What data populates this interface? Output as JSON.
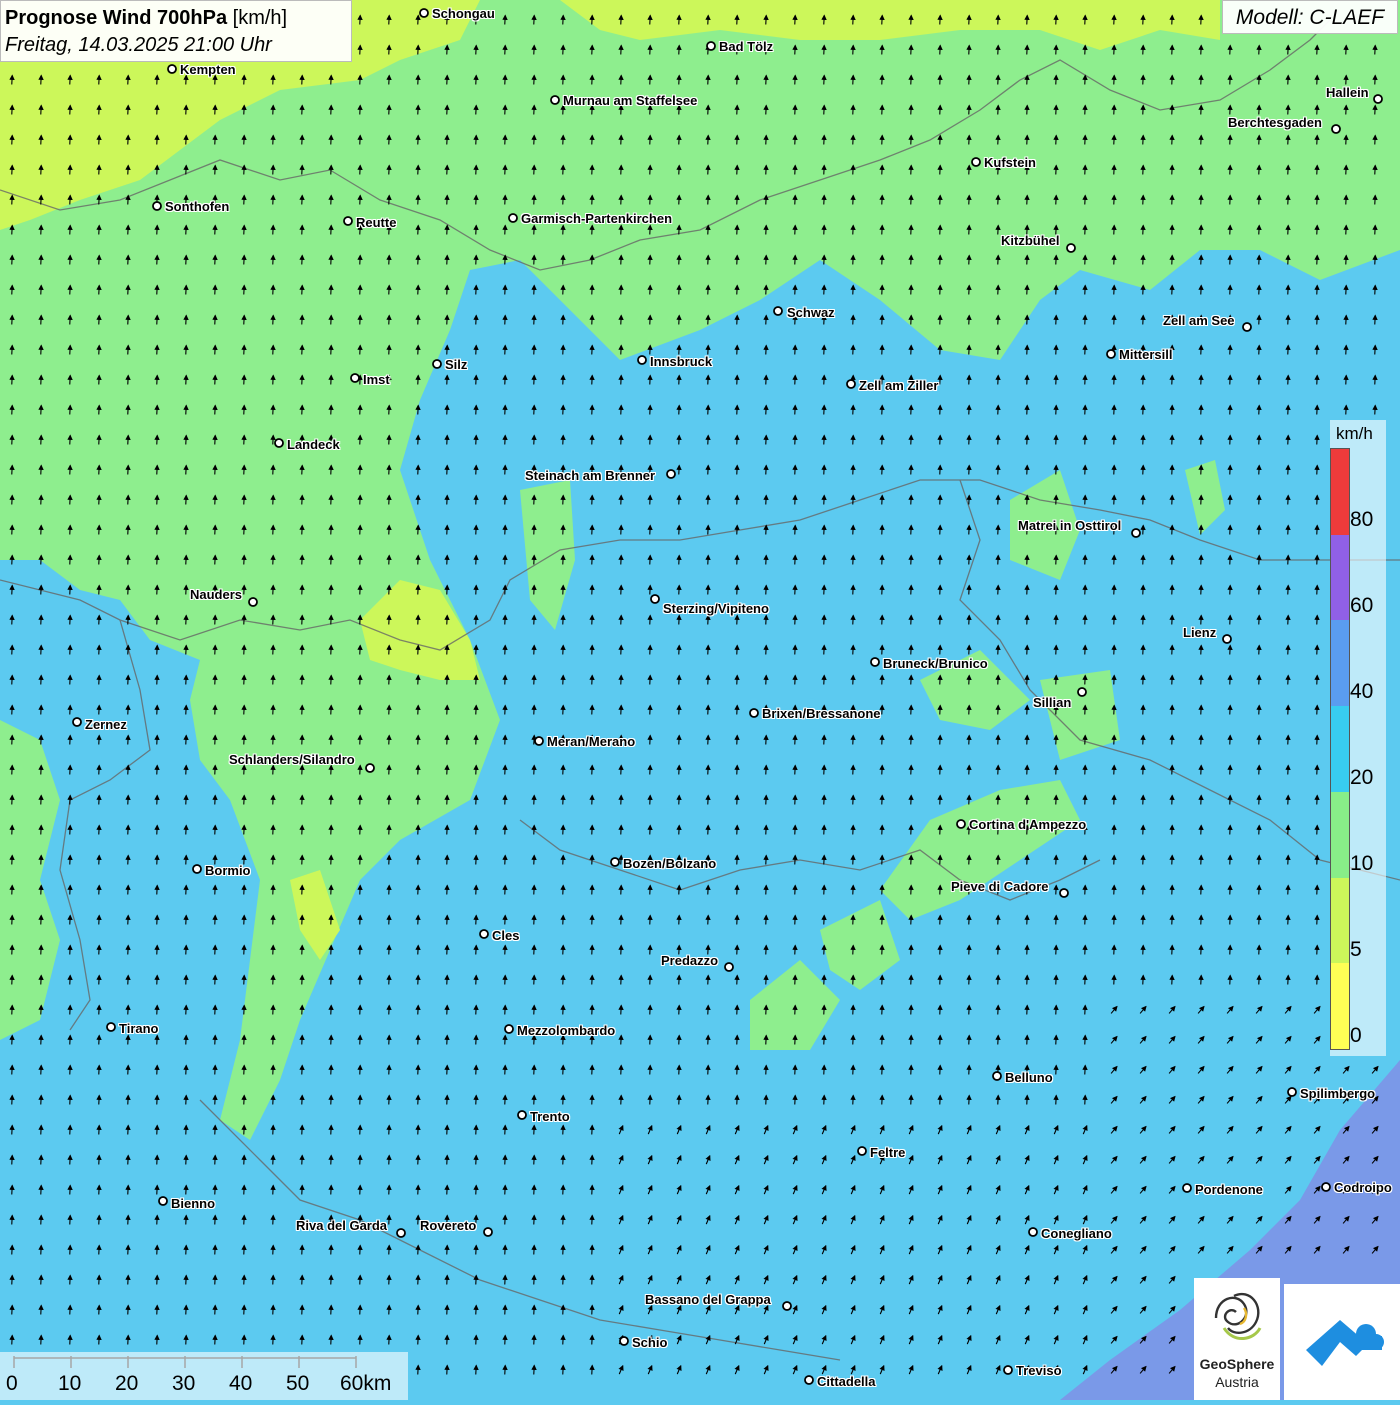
{
  "title": {
    "main": "Prognose Wind 700hPa",
    "unit": "[km/h]",
    "datetime": "Freitag, 14.03.2025 21:00 Uhr"
  },
  "model": "Modell: C-LAEF",
  "legend": {
    "unit": "km/h",
    "levels": [
      "0",
      "5",
      "10",
      "20",
      "40",
      "60",
      "80"
    ],
    "colors": [
      "#ffff55",
      "#ccf75a",
      "#88ee88",
      "#38ccf0",
      "#5a9cf0",
      "#9060e6",
      "#ee3b3b"
    ]
  },
  "scale": {
    "labels": [
      "0",
      "10",
      "20",
      "30",
      "40",
      "50",
      "60km"
    ]
  },
  "logos": {
    "geosphere_line1": "GeoSphere",
    "geosphere_line2": "Austria"
  },
  "cities": [
    {
      "name": "Schongau"
    },
    {
      "name": "Kempten"
    },
    {
      "name": "Bad Tölz"
    },
    {
      "name": "Murnau am Staffelsee"
    },
    {
      "name": "Hallein"
    },
    {
      "name": "Berchtesgaden"
    },
    {
      "name": "Kufstein"
    },
    {
      "name": "Sonthofen"
    },
    {
      "name": "Reutte"
    },
    {
      "name": "Garmisch-Partenkirchen"
    },
    {
      "name": "Kitzbühel"
    },
    {
      "name": "Schwaz"
    },
    {
      "name": "Zell am See"
    },
    {
      "name": "Innsbruck"
    },
    {
      "name": "Mittersill"
    },
    {
      "name": "Silz"
    },
    {
      "name": "Imst"
    },
    {
      "name": "Zell am Ziller"
    },
    {
      "name": "Landeck"
    },
    {
      "name": "Steinach am Brenner"
    },
    {
      "name": "Matrei in Osttirol"
    },
    {
      "name": "Nauders"
    },
    {
      "name": "Sterzing/Vipiteno"
    },
    {
      "name": "Lienz"
    },
    {
      "name": "Bruneck/Brunico"
    },
    {
      "name": "Sillian"
    },
    {
      "name": "Brixen/Bressanone"
    },
    {
      "name": "Zernez"
    },
    {
      "name": "Meran/Merano"
    },
    {
      "name": "Schlanders/Silandro"
    },
    {
      "name": "Cortina d'Ampezzo"
    },
    {
      "name": "Bozen/Bolzano"
    },
    {
      "name": "Bormio"
    },
    {
      "name": "Pieve di Cadore"
    },
    {
      "name": "Cles"
    },
    {
      "name": "Predazzo"
    },
    {
      "name": "Tirano"
    },
    {
      "name": "Mezzolombardo"
    },
    {
      "name": "Belluno"
    },
    {
      "name": "Spilimbergo"
    },
    {
      "name": "Trento"
    },
    {
      "name": "Feltre"
    },
    {
      "name": "Pordenone"
    },
    {
      "name": "Codroipo"
    },
    {
      "name": "Bienno"
    },
    {
      "name": "Riva del Garda"
    },
    {
      "name": "Rovereto"
    },
    {
      "name": "Conegliano"
    },
    {
      "name": "Bassano del Grappa"
    },
    {
      "name": "Schio"
    },
    {
      "name": "Treviso"
    },
    {
      "name": "Cittadella"
    }
  ]
}
